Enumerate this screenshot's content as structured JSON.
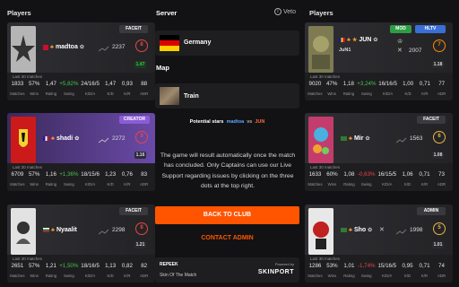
{
  "header": {
    "players_left": "Players",
    "server": "Server",
    "veto": "Veto",
    "players_right": "Players",
    "map": "Map"
  },
  "server": {
    "name": "Germany"
  },
  "map": {
    "name": "Train"
  },
  "potential_stars": {
    "label": "Potential stars",
    "left": "madtoa",
    "vs": "vs",
    "right": "JUN"
  },
  "message": "The game will result automatically once the match has concluded. Only Captains can use our Live Support regarding issues by clicking on the three dots at the top right.",
  "back_button": "BACK TO CLUB",
  "contact_admin": "CONTACT ADMIN",
  "skin": {
    "brand": "REPEEK",
    "title": "Skin Of The Match",
    "powered": "Powered by",
    "sponsor": "SKINPORT"
  },
  "stat_labels": [
    "Matches",
    "Wins",
    "Rating",
    "Swing",
    "K/D/A",
    "K/D",
    "K/R",
    "ADR"
  ],
  "last30": "Last 30 matches",
  "left_players": [
    {
      "name": "madtoa",
      "elo": "2237",
      "badge": "FACEIT",
      "level": "8",
      "rating_pill": "1.47",
      "stats": [
        "1833",
        "57%",
        "1,47",
        "+5,82%",
        "24/16/5",
        "1,47",
        "0,93",
        "88"
      ],
      "colors": {
        "top": "#2b2b2e",
        "badge": "#3a3a3e",
        "lvl": "#ff8a00"
      }
    },
    {
      "name": "shadi",
      "elo": "2272",
      "badge": "CREATOR",
      "level": "9",
      "rating_pill": "1.16",
      "stats": [
        "6709",
        "57%",
        "1,16",
        "+1,36%",
        "18/15/6",
        "1,23",
        "0,76",
        "83"
      ],
      "colors": {
        "top": "#5a3a8a",
        "badge": "#8a5cd6",
        "lvl": "#e84545"
      }
    },
    {
      "name": "Nyaalit",
      "elo": "2298",
      "badge": "FACEIT",
      "level": "8",
      "rating_pill": "1.21",
      "stats": [
        "2651",
        "57%",
        "1,21",
        "+1,50%",
        "18/16/5",
        "1,13",
        "0,82",
        "82"
      ],
      "colors": {
        "top": "#2b2b2e",
        "badge": "#3a3a3e",
        "lvl": "#e84545"
      }
    }
  ],
  "right_players": [
    {
      "name": "JUN",
      "elo": "2007",
      "subname": "JuN1",
      "badges": [
        "MOD",
        "HLTV"
      ],
      "level": "7",
      "rating_pill": "1.18",
      "stats": [
        "9020",
        "47%",
        "1,18",
        "+3,24%",
        "16/16/5",
        "1,00",
        "0,71",
        "77"
      ],
      "colors": {
        "top": "#2b2b2e",
        "lvl": "#ff8a00"
      }
    },
    {
      "name": "Mir",
      "elo": "1563",
      "badge": "FACEIT",
      "level": "6",
      "rating_pill": "1.08",
      "stats": [
        "1633",
        "60%",
        "1,08",
        "-0,63%",
        "16/15/5",
        "1,06",
        "0,71",
        "73"
      ],
      "colors": {
        "top": "#2b2b2e",
        "badge": "#3a3a3e",
        "lvl": "#e8b845"
      }
    },
    {
      "name": "Sho",
      "elo": "1998",
      "badge": "ADMIN",
      "level": "5",
      "rating_pill": "1.01",
      "stats": [
        "1286",
        "53%",
        "1,01",
        "-1,74%",
        "15/16/5",
        "0,95",
        "0,71",
        "74"
      ],
      "colors": {
        "top": "#2b2b2e",
        "badge": "#3a3a3e",
        "lvl": "#e8b845"
      }
    }
  ]
}
